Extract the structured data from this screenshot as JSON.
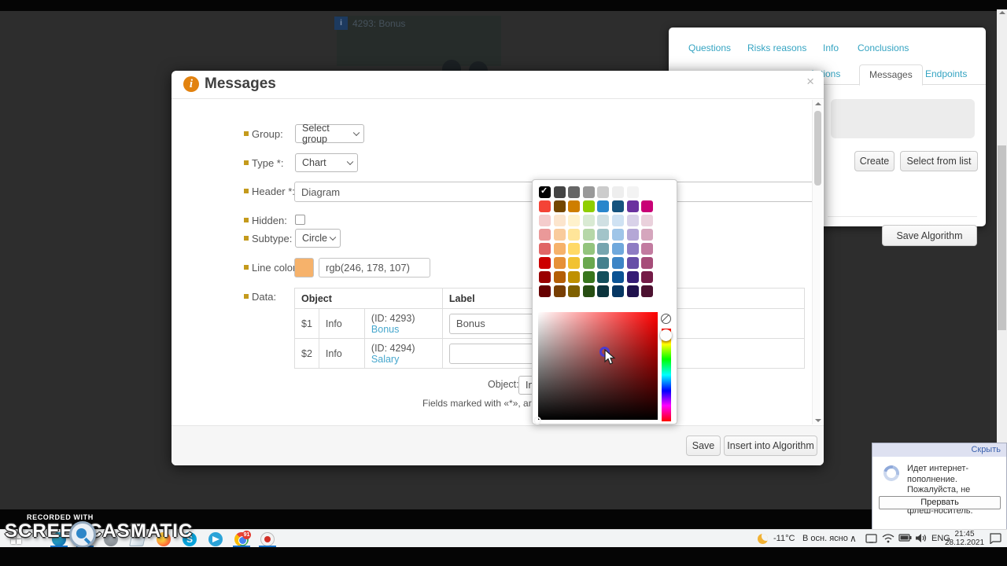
{
  "background": {
    "card_text": "4293: Bonus",
    "card_icon": "i"
  },
  "panel": {
    "links": [
      {
        "label": "Questions"
      },
      {
        "label": "Risks reasons"
      },
      {
        "label": "Info"
      },
      {
        "label": "Conclusions"
      }
    ],
    "tabs": [
      {
        "label": "Actions",
        "active": false
      },
      {
        "label": "Messages",
        "active": true
      },
      {
        "label": "Endpoints",
        "active": false
      }
    ],
    "create_label": "Create",
    "select_from_list_label": "Select from list",
    "save_algorithm_label": "Save Algorithm"
  },
  "modal": {
    "title": "Messages",
    "title_icon": "i",
    "close": "×",
    "fields": {
      "group_label": "Group:",
      "group_value": "Select group",
      "type_label": "Type *:",
      "type_value": "Chart",
      "header_label": "Header *:",
      "header_value": "Diagram",
      "hidden_label": "Hidden:",
      "subtype_label": "Subtype:",
      "subtype_value": "Circle",
      "line_color_label": "Line color:",
      "line_color_value": "rgb(246, 178, 107)",
      "line_color_hex": "#f6b26b",
      "data_label": "Data:"
    },
    "table": {
      "header_object": "Object",
      "header_label": "Label",
      "rows": [
        {
          "num": "$1",
          "type": "Info",
          "id": "(ID: 4293)",
          "link": "Bonus",
          "label_value": "Bonus"
        },
        {
          "num": "$2",
          "type": "Info",
          "id": "(ID: 4294)",
          "link": "Salary",
          "label_value": ""
        }
      ]
    },
    "object_label": "Object:",
    "object_value": "Info",
    "note": "Fields marked with «*», are required",
    "save_label": "Save",
    "insert_label": "Insert into Algorithm"
  },
  "picker": {
    "selected_index": 0,
    "palette": [
      "#000000",
      "#444444",
      "#666666",
      "#999999",
      "#cccccc",
      "#eeeeee",
      "#f3f3f3",
      "#ffffff",
      "#f44336",
      "#744700",
      "#ce7e00",
      "#8fce00",
      "#2986cc",
      "#16537e",
      "#6a329f",
      "#c90076",
      "#f4cccc",
      "#fce5cd",
      "#fff2cc",
      "#d9ead3",
      "#d0e0e3",
      "#cfe2f3",
      "#d9d2e9",
      "#ead1dc",
      "#ea9999",
      "#f9cb9c",
      "#ffe599",
      "#b6d7a8",
      "#a2c4c9",
      "#9fc5e8",
      "#b4a7d6",
      "#d5a6bd",
      "#e06666",
      "#f6b26b",
      "#ffd966",
      "#93c47d",
      "#76a5af",
      "#6fa8dc",
      "#8e7cc3",
      "#c27ba0",
      "#cc0000",
      "#e69138",
      "#f1c232",
      "#6aa84f",
      "#45818e",
      "#3d85c6",
      "#674ea7",
      "#a64d79",
      "#990000",
      "#b45f06",
      "#bf9000",
      "#38761d",
      "#134f5c",
      "#0b5394",
      "#351c75",
      "#741b47",
      "#660000",
      "#783f04",
      "#7f6000",
      "#274e13",
      "#0c343d",
      "#073763",
      "#20124d",
      "#4c1130"
    ]
  },
  "notification": {
    "hide_label": "Скрыть",
    "line1": "Идет интернет-пополнение.",
    "line2": "Пожалуйста, не извлекайте",
    "line3": "флеш-носитель.",
    "abort_label": "Прервать"
  },
  "watermark": {
    "recorded_with": "RECORDED WITH",
    "part1": "SCREENCAST",
    "part2": "MATIC"
  },
  "taskbar": {
    "chrome_badge": "91",
    "skype_letter": "S",
    "weather_temp": "-11°C",
    "weather_desc": "В осн. ясно",
    "chevron": "∧",
    "lang": "ENG",
    "time": "21:45",
    "date": "28.12.2021"
  }
}
